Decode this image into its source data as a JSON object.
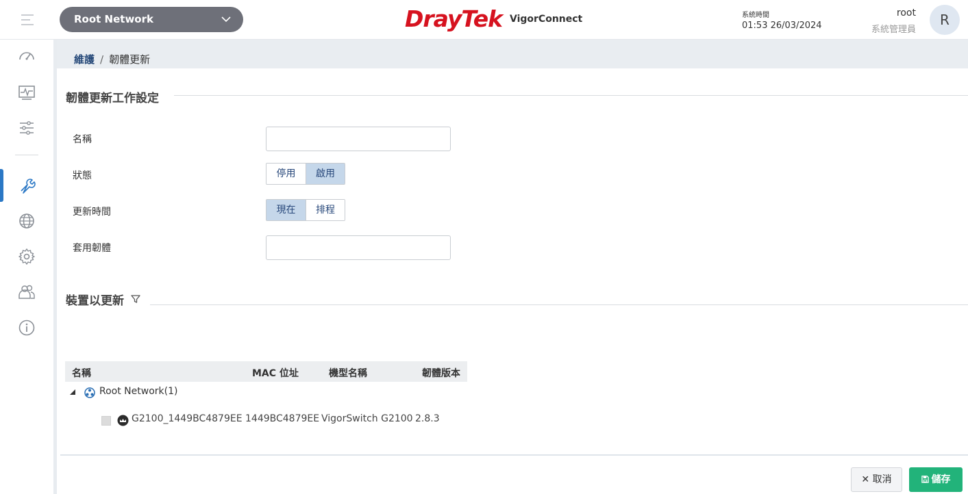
{
  "header": {
    "network_select": "Root Network",
    "brand": "DrayTek",
    "product": "VigorConnect",
    "time_label": "系統時間",
    "time_value": "01:53 26/03/2024",
    "user_name": "root",
    "user_role": "系統管理員",
    "avatar_initial": "R"
  },
  "sidebar": {
    "items": [
      {
        "icon": "dashboard-gauge-icon"
      },
      {
        "icon": "monitoring-chart-icon"
      },
      {
        "icon": "settings-sliders-icon"
      },
      {
        "icon": "maintenance-wrench-icon",
        "active": true
      },
      {
        "icon": "globe-icon"
      },
      {
        "icon": "gear-icon"
      },
      {
        "icon": "users-icon"
      },
      {
        "icon": "info-icon"
      }
    ],
    "active_color": "#2b78c5"
  },
  "breadcrumb": {
    "parent": "維護",
    "separator": "/",
    "current": "韌體更新"
  },
  "job_settings": {
    "title": "韌體更新工作設定",
    "name_label": "名稱",
    "name_value": "",
    "status_label": "狀態",
    "status_options": [
      "停用",
      "啟用"
    ],
    "status_selected": "啟用",
    "update_time_label": "更新時間",
    "update_time_options": [
      "現在",
      "排程"
    ],
    "update_time_selected": "現在",
    "firmware_label": "套用韌體",
    "firmware_value": ""
  },
  "devices": {
    "title": "裝置以更新",
    "columns": [
      "名稱",
      "MAC 位址",
      "機型名稱",
      "韌體版本"
    ],
    "group_name": "Root Network(1)",
    "rows": [
      {
        "name": "G2100_1449BC4879EE",
        "mac": "1449BC4879EE",
        "model": "VigorSwitch G2100",
        "firmware": "2.8.3"
      }
    ]
  },
  "actions": {
    "cancel_label": "取消",
    "save_label": "儲存",
    "save_color": "#22b37a"
  }
}
